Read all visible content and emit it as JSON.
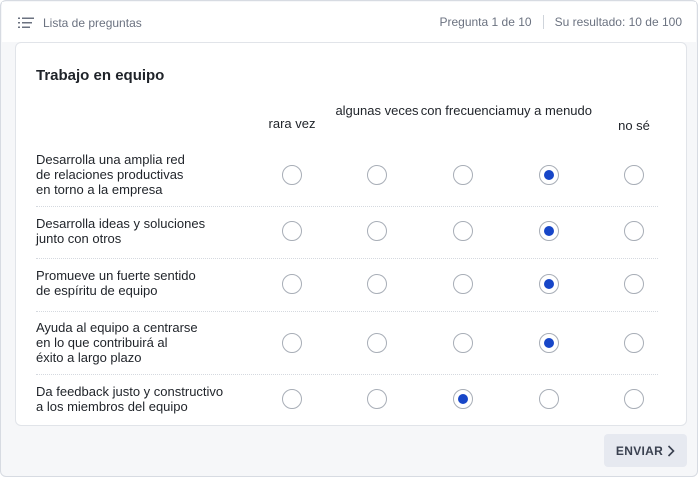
{
  "header": {
    "list_label": "Lista de preguntas",
    "question_progress": "Pregunta 1 de 10",
    "result": "Su resultado: 10 de 100"
  },
  "section": {
    "title": "Trabajo en equipo"
  },
  "columns": [
    {
      "label": "rara vez"
    },
    {
      "label": "algunas veces"
    },
    {
      "label": "con frecuencia"
    },
    {
      "label": "muy a menudo"
    },
    {
      "label": "no sé"
    }
  ],
  "rows": [
    {
      "label": "Desarrolla una amplia red\nde relaciones productivas\nen torno a la empresa",
      "selected": 3
    },
    {
      "label": "Desarrolla ideas y soluciones\njunto con otros",
      "selected": 3
    },
    {
      "label": "Promueve un fuerte sentido\nde espíritu de equipo",
      "selected": 3
    },
    {
      "label": "Ayuda al equipo a centrarse\nen lo que contribuirá al\néxito a largo plazo",
      "selected": 3
    },
    {
      "label": "Da feedback justo y constructivo\na los miembros del equipo",
      "selected": 2
    }
  ],
  "actions": {
    "send_label": "ENVIAR"
  },
  "icons": {
    "list": "list-icon",
    "send": "chevron-right-icon"
  },
  "colors": {
    "accent": "#1746c8",
    "button_bg": "#e6e9f0"
  }
}
